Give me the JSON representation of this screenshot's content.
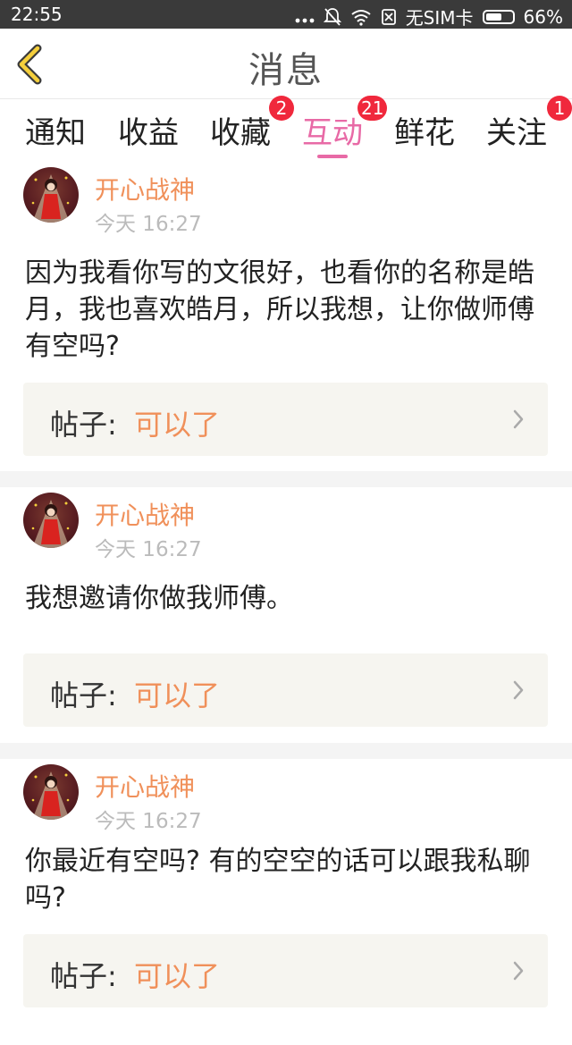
{
  "status_bar": {
    "time": "22:55",
    "carrier": "无SIM卡",
    "battery": "66%",
    "battery_level": 0.66
  },
  "header": {
    "title": "消息",
    "back_icon": "chevron-left-icon"
  },
  "tabs": [
    {
      "label": "通知",
      "badge": "",
      "active": false
    },
    {
      "label": "收益",
      "badge": "",
      "active": false
    },
    {
      "label": "收藏",
      "badge": "2",
      "active": false
    },
    {
      "label": "互动",
      "badge": "21",
      "active": true
    },
    {
      "label": "鲜花",
      "badge": "",
      "active": false
    },
    {
      "label": "关注",
      "badge": "1",
      "active": false
    }
  ],
  "colors": {
    "accent": "#e86aa6",
    "username": "#f0905a",
    "badge": "#f0283c"
  },
  "messages": [
    {
      "user": "开心战神",
      "time": "今天 16:27",
      "text": "因为我看你写的文很好，也看你的名称是皓月，我也喜欢皓月，所以我想，让你做师傅有空吗?",
      "post_prefix": "帖子:",
      "post_title": "可以了"
    },
    {
      "user": "开心战神",
      "time": "今天 16:27",
      "text": "我想邀请你做我师傅。",
      "post_prefix": "帖子:",
      "post_title": "可以了"
    },
    {
      "user": "开心战神",
      "time": "今天 16:27",
      "text": "你最近有空吗? 有的空空的话可以跟我私聊吗?",
      "post_prefix": "帖子:",
      "post_title": "可以了"
    }
  ]
}
